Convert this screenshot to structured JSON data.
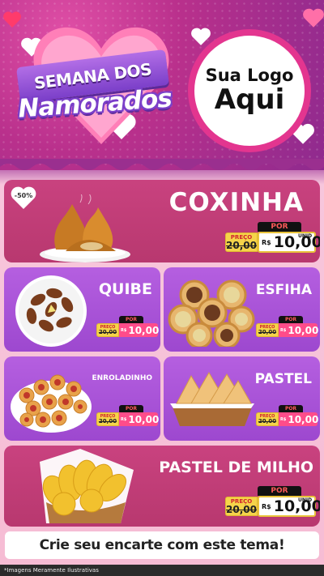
{
  "header": {
    "line1": "SEMANA DOS",
    "line2": "Namorados",
    "logo_line1": "Sua Logo",
    "logo_line2": "Aqui"
  },
  "featured": {
    "title": "COXINHA",
    "badge": "-50%",
    "por": "POR",
    "preco_label": "PREÇO",
    "old_price": "20,00",
    "currency": "R$",
    "price": "10,00",
    "unit": "UNID"
  },
  "grid": [
    {
      "title": "QUIBE",
      "por": "POR",
      "preco_label": "PREÇO",
      "old_price": "20,00",
      "currency": "R$",
      "price": "10,00"
    },
    {
      "title": "ESFIHA",
      "por": "POR",
      "preco_label": "PREÇO",
      "old_price": "20,00",
      "currency": "R$",
      "price": "10,00"
    },
    {
      "title": "ENROLADINHO",
      "por": "POR",
      "preco_label": "PREÇO",
      "old_price": "20,00",
      "currency": "R$",
      "price": "10,00"
    },
    {
      "title": "PASTEL",
      "por": "POR",
      "preco_label": "PREÇO",
      "old_price": "20,00",
      "currency": "R$",
      "price": "10,00"
    }
  ],
  "bottom_item": {
    "title": "PASTEL DE MILHO",
    "por": "POR",
    "preco_label": "PREÇO",
    "old_price": "20,00",
    "currency": "R$",
    "price": "10,00",
    "unit": "UNID"
  },
  "cta": "Crie seu encarte com este tema!",
  "disclaimer": "*Imagens Meramente Ilustrativas",
  "colors": {
    "header_magenta": "#b9308c",
    "card_pink": "#c9427f",
    "card_purple": "#9d48cf",
    "price_yellow": "#f5d44a",
    "price_tag_pink": "#ff4c8a"
  }
}
